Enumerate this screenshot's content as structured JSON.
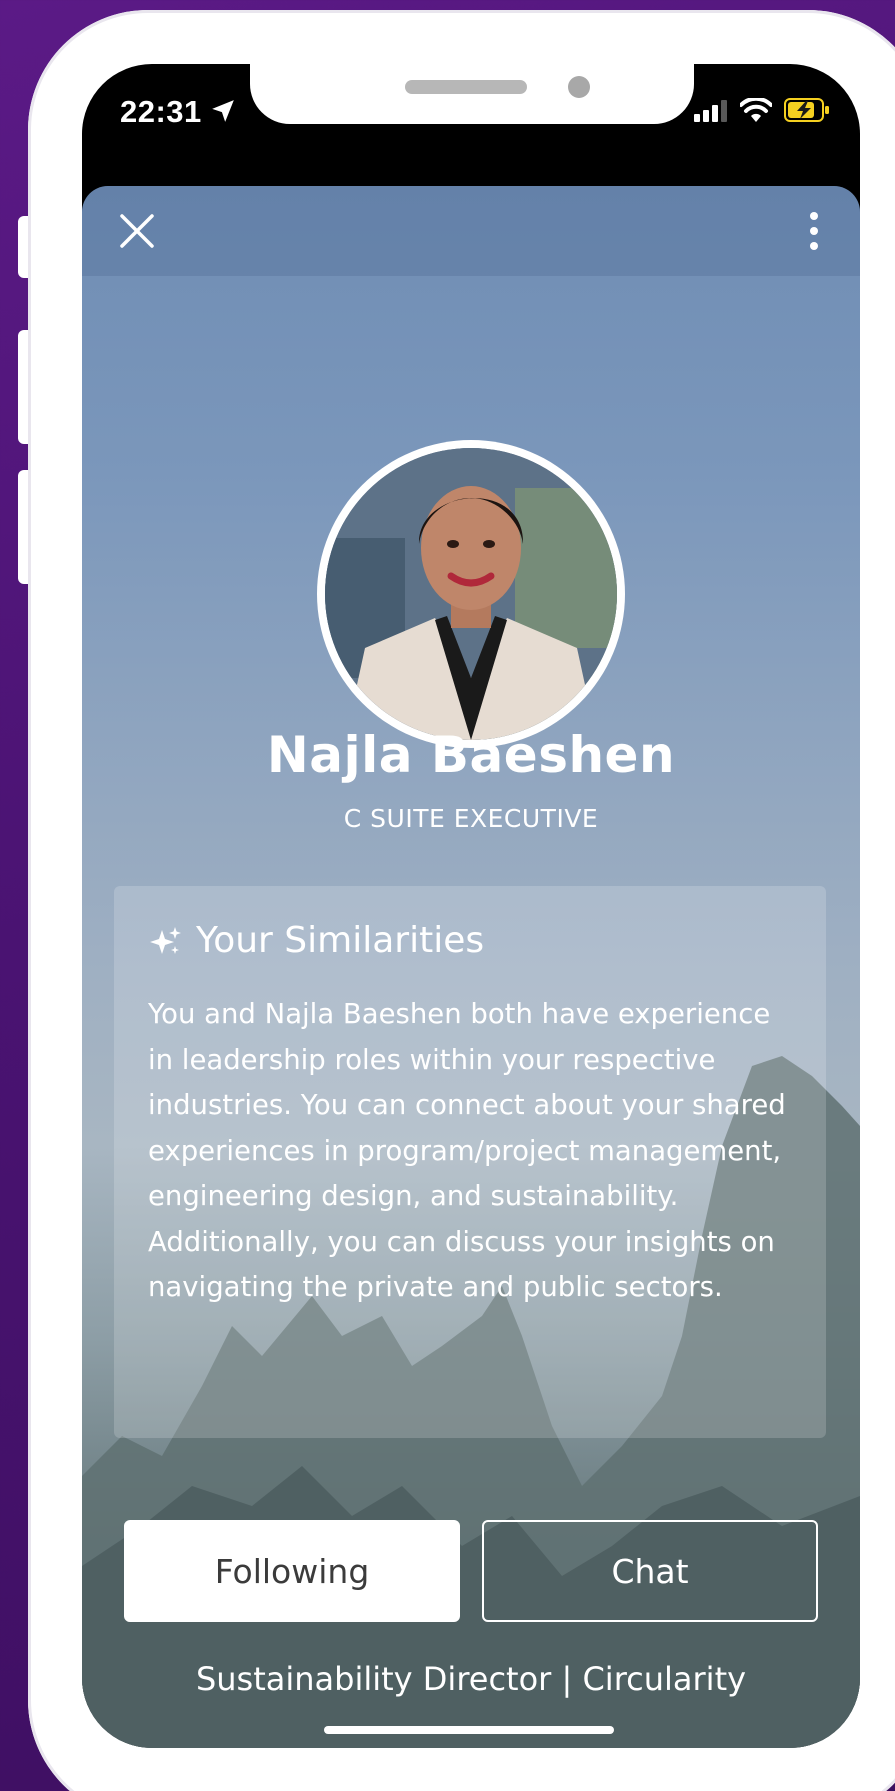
{
  "status_bar": {
    "time": "22:31",
    "icons": [
      "location-arrow-icon",
      "cellular-signal-icon",
      "wifi-icon",
      "battery-charging-icon"
    ]
  },
  "colors": {
    "background": "#4a1372",
    "battery": "#f5d020",
    "sheet_top": "#6f8db4",
    "button_text": "#3b3b3b"
  },
  "profile": {
    "name": "Najla Baeshen",
    "role": "C SUITE EXECUTIVE",
    "headline": "Sustainability Director | Circularity"
  },
  "similarities": {
    "icon": "sparkles-icon",
    "title": "Your Similarities",
    "text": "You and Najla Baeshen both have experience in leadership roles within your respective industries. You can connect about your shared experiences in program/project management, engineering design, and sustainability. Additionally, you can discuss your insights on navigating the private and public sectors."
  },
  "actions": {
    "following_label": "Following",
    "chat_label": "Chat"
  }
}
